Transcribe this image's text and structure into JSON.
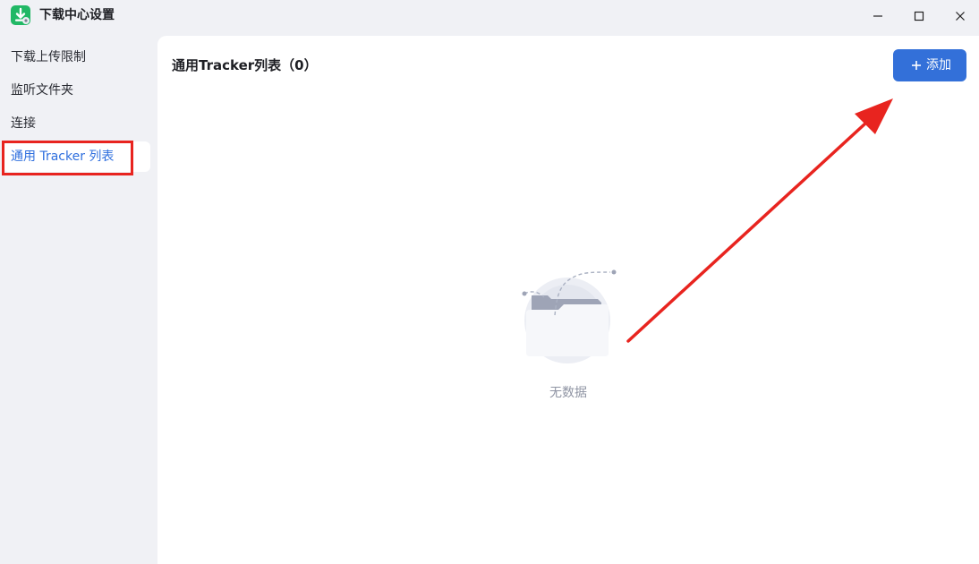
{
  "window": {
    "title": "下载中心设置",
    "controls": [
      "minimize-icon",
      "maximize-icon",
      "close-icon"
    ]
  },
  "sidebar": {
    "items": [
      {
        "label": "下载上传限制",
        "active": false
      },
      {
        "label": "监听文件夹",
        "active": false
      },
      {
        "label": "连接",
        "active": false
      },
      {
        "label": "通用 Tracker 列表",
        "active": true
      }
    ]
  },
  "main": {
    "title": "通用Tracker列表（0）",
    "add_button": {
      "label": "添加",
      "icon": "plus-icon"
    },
    "empty_state": {
      "text": "无数据",
      "icon": "empty-folder-icon"
    }
  },
  "colors": {
    "accent": "#3370d9",
    "active_text": "#2f6fde",
    "annotation": "#e8241f",
    "app_icon": "#21b865"
  }
}
